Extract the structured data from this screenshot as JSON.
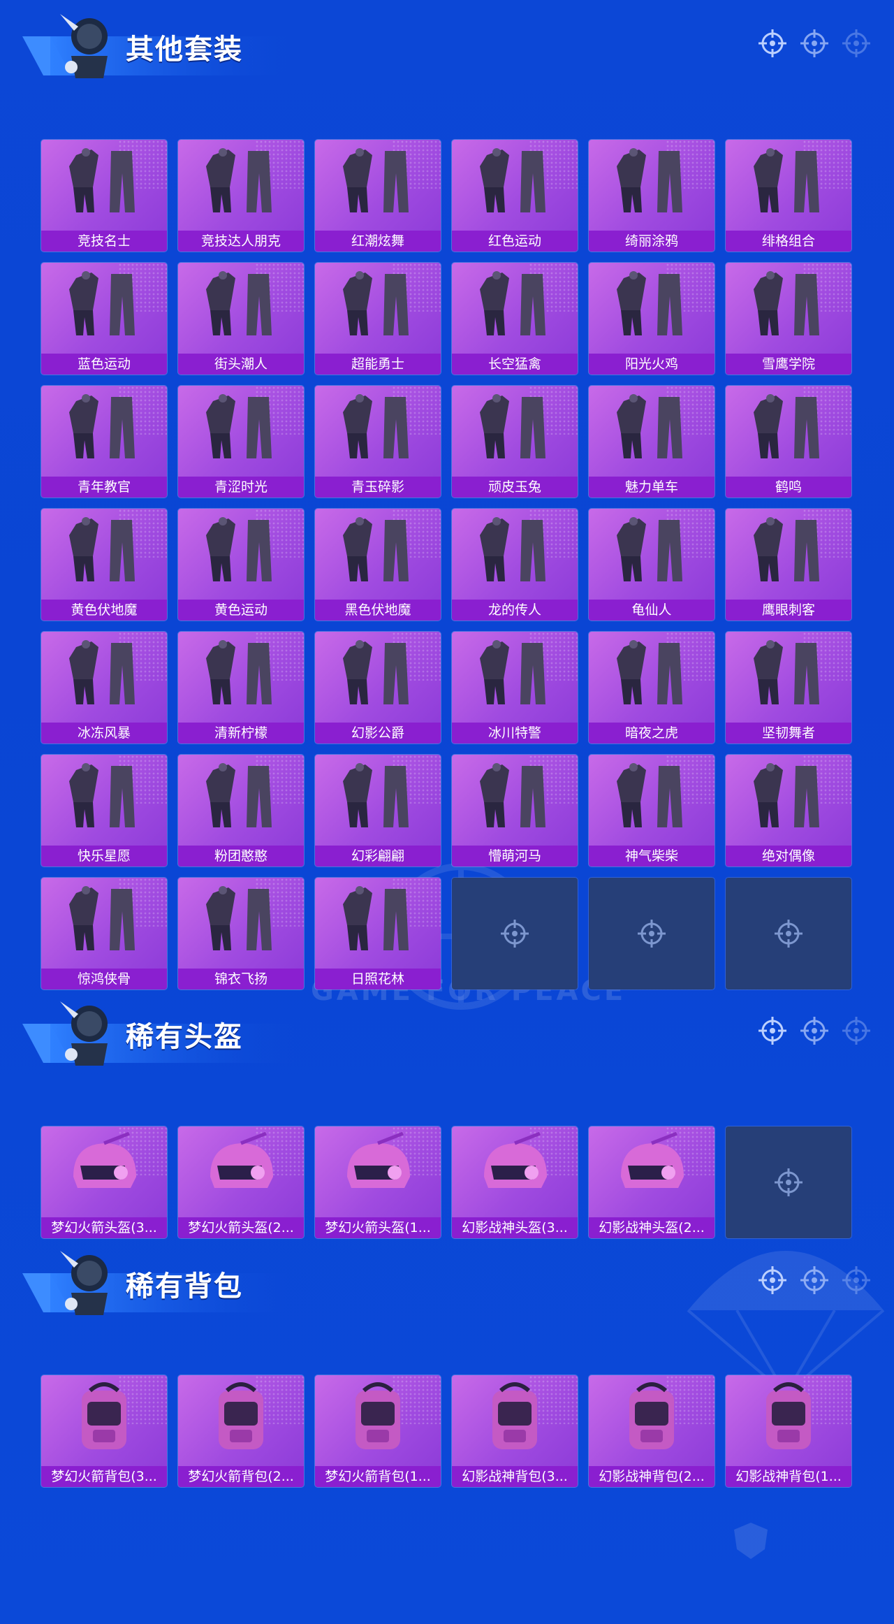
{
  "background": {
    "watermark": "GAME FOR PEACE"
  },
  "colors": {
    "page_bg": "#0c47d6",
    "card_bg": "#a04be0",
    "label_bg": "#8a1fd0",
    "empty_bg": "#263f78"
  },
  "sections": [
    {
      "title": "其他套装",
      "items": [
        {
          "label": "竞技名士",
          "icon": "suit-icon"
        },
        {
          "label": "竞技达人朋克",
          "icon": "suit-icon"
        },
        {
          "label": "红潮炫舞",
          "icon": "suit-icon"
        },
        {
          "label": "红色运动",
          "icon": "suit-icon"
        },
        {
          "label": "绮丽涂鸦",
          "icon": "suit-icon"
        },
        {
          "label": "绯格组合",
          "icon": "suit-icon"
        },
        {
          "label": "蓝色运动",
          "icon": "suit-icon"
        },
        {
          "label": "街头潮人",
          "icon": "suit-icon"
        },
        {
          "label": "超能勇士",
          "icon": "suit-icon"
        },
        {
          "label": "长空猛禽",
          "icon": "suit-icon"
        },
        {
          "label": "阳光火鸡",
          "icon": "suit-icon"
        },
        {
          "label": "雪鹰学院",
          "icon": "suit-icon"
        },
        {
          "label": "青年教官",
          "icon": "suit-icon"
        },
        {
          "label": "青涩时光",
          "icon": "suit-icon"
        },
        {
          "label": "青玉碎影",
          "icon": "suit-icon"
        },
        {
          "label": "顽皮玉兔",
          "icon": "suit-icon"
        },
        {
          "label": "魅力单车",
          "icon": "suit-icon"
        },
        {
          "label": "鹤鸣",
          "icon": "suit-icon"
        },
        {
          "label": "黄色伏地魔",
          "icon": "suit-icon"
        },
        {
          "label": "黄色运动",
          "icon": "suit-icon"
        },
        {
          "label": "黑色伏地魔",
          "icon": "suit-icon"
        },
        {
          "label": "龙的传人",
          "icon": "suit-icon"
        },
        {
          "label": "龟仙人",
          "icon": "suit-icon"
        },
        {
          "label": "鹰眼刺客",
          "icon": "suit-icon"
        },
        {
          "label": "冰冻风暴",
          "icon": "suit-icon"
        },
        {
          "label": "清新柠檬",
          "icon": "suit-icon"
        },
        {
          "label": "幻影公爵",
          "icon": "suit-icon"
        },
        {
          "label": "冰川特警",
          "icon": "suit-icon"
        },
        {
          "label": "暗夜之虎",
          "icon": "suit-icon"
        },
        {
          "label": "坚韧舞者",
          "icon": "suit-icon"
        },
        {
          "label": "快乐星愿",
          "icon": "suit-icon"
        },
        {
          "label": "粉团憨憨",
          "icon": "suit-icon"
        },
        {
          "label": "幻彩翩翩",
          "icon": "suit-icon"
        },
        {
          "label": "懵萌河马",
          "icon": "suit-icon"
        },
        {
          "label": "神气柴柴",
          "icon": "suit-icon"
        },
        {
          "label": "绝对偶像",
          "icon": "suit-icon"
        },
        {
          "label": "惊鸿侠骨",
          "icon": "suit-icon"
        },
        {
          "label": "锦衣飞扬",
          "icon": "suit-icon"
        },
        {
          "label": "日照花林",
          "icon": "suit-icon"
        }
      ],
      "empty_slots": 3
    },
    {
      "title": "稀有头盔",
      "items": [
        {
          "label": "梦幻火箭头盔(3...",
          "icon": "helmet-icon"
        },
        {
          "label": "梦幻火箭头盔(2...",
          "icon": "helmet-icon"
        },
        {
          "label": "梦幻火箭头盔(1...",
          "icon": "helmet-icon"
        },
        {
          "label": "幻影战神头盔(3...",
          "icon": "helmet-icon"
        },
        {
          "label": "幻影战神头盔(2...",
          "icon": "helmet-icon"
        }
      ],
      "empty_slots": 1
    },
    {
      "title": "稀有背包",
      "items": [
        {
          "label": "梦幻火箭背包(3...",
          "icon": "backpack-icon"
        },
        {
          "label": "梦幻火箭背包(2...",
          "icon": "backpack-icon"
        },
        {
          "label": "梦幻火箭背包(1...",
          "icon": "backpack-icon"
        },
        {
          "label": "幻影战神背包(3...",
          "icon": "backpack-icon"
        },
        {
          "label": "幻影战神背包(2...",
          "icon": "backpack-icon"
        },
        {
          "label": "幻影战神背包(1...",
          "icon": "backpack-icon"
        }
      ],
      "empty_slots": 0
    }
  ]
}
